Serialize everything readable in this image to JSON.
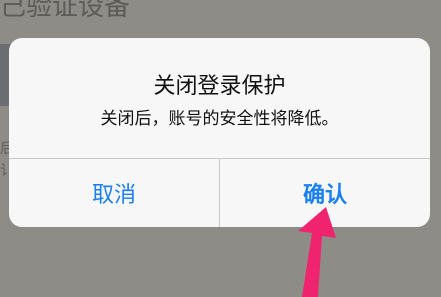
{
  "background": {
    "title": "己验证设备",
    "side_text": "后\n讠"
  },
  "dialog": {
    "title": "关闭登录保护",
    "message": "关闭后，账号的安全性将降低。",
    "cancel_label": "取消",
    "confirm_label": "确认"
  },
  "colors": {
    "accent": "#1a7ff0",
    "overlay": "#8e8c87",
    "annotation_arrow": "#f0246e"
  }
}
